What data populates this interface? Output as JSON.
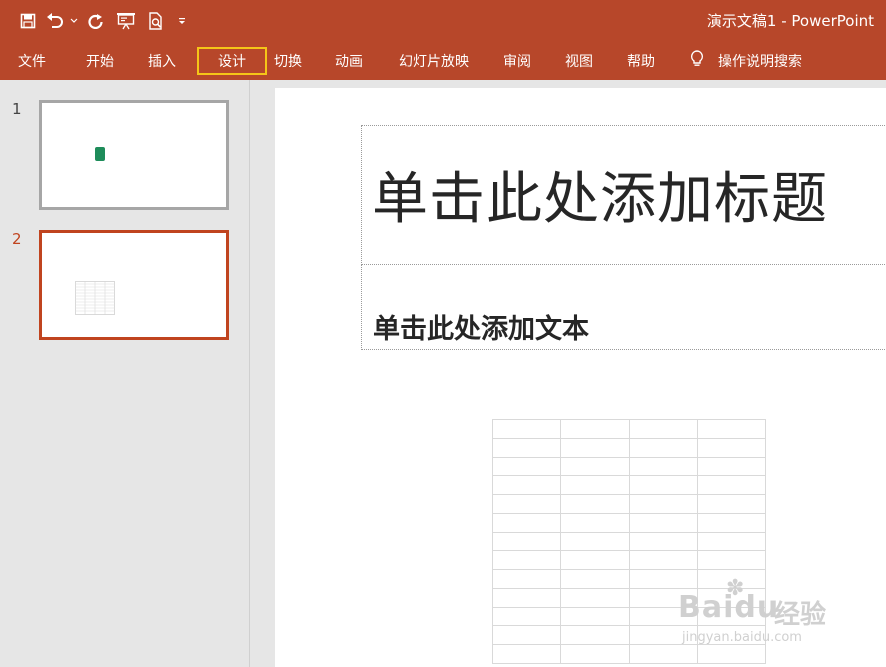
{
  "window": {
    "title": "演示文稿1  -  PowerPoint"
  },
  "qat": {
    "save": "save-icon",
    "undo": "undo-icon",
    "undo_dropdown": "chevron-down-icon",
    "redo": "redo-icon",
    "present": "present-from-start-icon",
    "print_preview": "print-preview-icon",
    "customize": "customize-qat-icon"
  },
  "tabs": [
    "文件",
    "开始",
    "插入",
    "设计",
    "切换",
    "动画",
    "幻灯片放映",
    "审阅",
    "视图",
    "帮助"
  ],
  "highlighted_tab": "设计",
  "tellme": {
    "icon": "lightbulb-icon",
    "label": "操作说明搜索"
  },
  "slides": [
    {
      "number": "1",
      "selected": false
    },
    {
      "number": "2",
      "selected": true
    }
  ],
  "slide": {
    "title_placeholder": "单击此处添加标题",
    "body_placeholder": "单击此处添加文本",
    "table": {
      "rows": 13,
      "cols": 4
    }
  },
  "watermark": {
    "brand": "Bai",
    "brand2": "du",
    "product": "经验",
    "url": "jingyan.baidu.com"
  },
  "colors": {
    "ribbon": "#b7472a",
    "accent": "#c0441f",
    "highlight_box": "#f5c518"
  }
}
